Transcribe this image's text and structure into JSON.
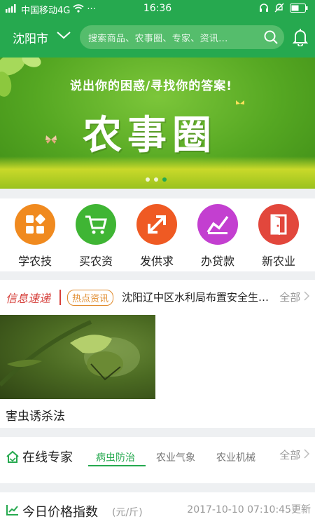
{
  "status_bar": {
    "carrier": "中国移动4G",
    "time": "16:36",
    "extra": "···"
  },
  "header": {
    "city": "沈阳市",
    "search_placeholder": "搜索商品、农事圈、专家、资讯..."
  },
  "banner": {
    "slogan": "说出你的困惑/寻找你的答案!",
    "title": "农事圈",
    "slides": 3,
    "active_slide": 3
  },
  "quick_actions": [
    {
      "label": "学农技",
      "color": "#f08a1f",
      "icon": "grid-icon"
    },
    {
      "label": "买农资",
      "color": "#3fb534",
      "icon": "cart-icon"
    },
    {
      "label": "发供求",
      "color": "#ef5a23",
      "icon": "arrows-icon"
    },
    {
      "label": "办贷款",
      "color": "#c33fd0",
      "icon": "chart-icon"
    },
    {
      "label": "新农业",
      "color": "#e2473c",
      "icon": "door-icon"
    }
  ],
  "news": {
    "brand": "信息速递",
    "badge": "热点资讯",
    "headline": "沈阳辽中区水利局布置安全生产工作",
    "more": "全部"
  },
  "article": {
    "caption": "害虫诱杀法"
  },
  "experts": {
    "title": "在线专家",
    "tabs": [
      "病虫防治",
      "农业气象",
      "农业机械"
    ],
    "active_tab": 0,
    "more": "全部"
  },
  "price_index": {
    "title": "今日价格指数",
    "unit": "(元/斤)",
    "updated": "2017-10-10 07:10:45更新"
  },
  "colors": {
    "brand_green": "#26a94f",
    "page_bg": "#eef0f2"
  }
}
